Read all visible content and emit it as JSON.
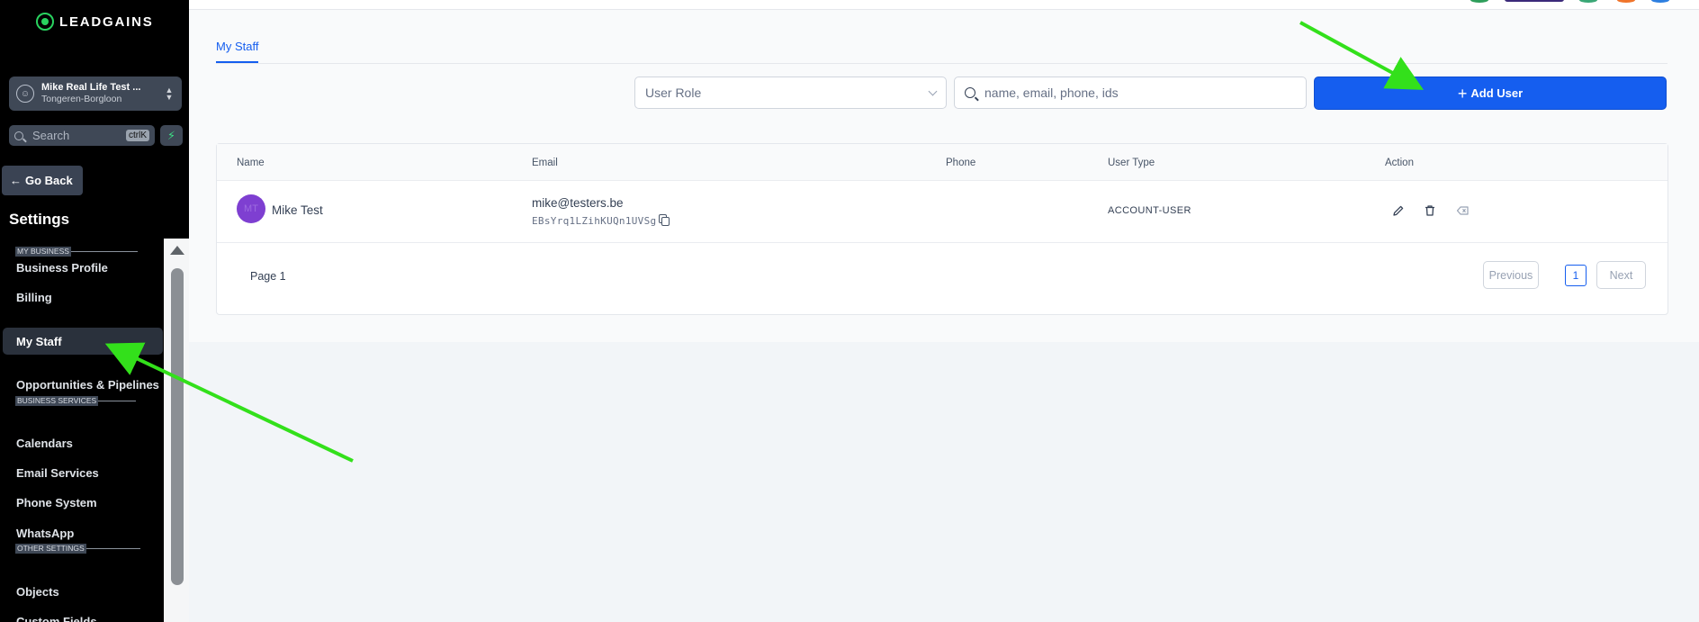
{
  "brand": {
    "logo_text": "LEADGAINS"
  },
  "location": {
    "name": "Mike Real Life Test ...",
    "sub": "Tongeren-Borgloon"
  },
  "search": {
    "label": "Search",
    "shortcut": "ctrlK"
  },
  "goback": {
    "label": "Go Back"
  },
  "settings_title": "Settings",
  "nav": {
    "sections": [
      "MY BUSINESS",
      "BUSINESS SERVICES",
      "OTHER SETTINGS"
    ],
    "items": [
      "Business Profile",
      "Billing",
      "My Staff",
      "Opportunities & Pipelines",
      "Calendars",
      "Email Services",
      "Phone System",
      "WhatsApp",
      "Objects",
      "Custom Fields"
    ],
    "active": "My Staff"
  },
  "tabs": {
    "my_staff": "My Staff"
  },
  "filters": {
    "role_placeholder": "User Role",
    "search_placeholder": "name, email, phone, ids"
  },
  "actions": {
    "add_user": "Add User"
  },
  "table": {
    "headers": [
      "Name",
      "Email",
      "Phone",
      "User Type",
      "Action"
    ],
    "rows": [
      {
        "initials": "MT",
        "name": "Mike Test",
        "email": "mike@testers.be",
        "id": "EBsYrq1LZihKUQn1UVSg",
        "phone": "",
        "type": "ACCOUNT-USER"
      }
    ]
  },
  "pagination": {
    "page_label": "Page 1",
    "previous": "Previous",
    "current": "1",
    "next": "Next"
  },
  "colors": {
    "primary": "#155eef",
    "sidebar": "#000000",
    "annotation_arrow": "#33e01b",
    "avatar": "#7e3fd1"
  }
}
